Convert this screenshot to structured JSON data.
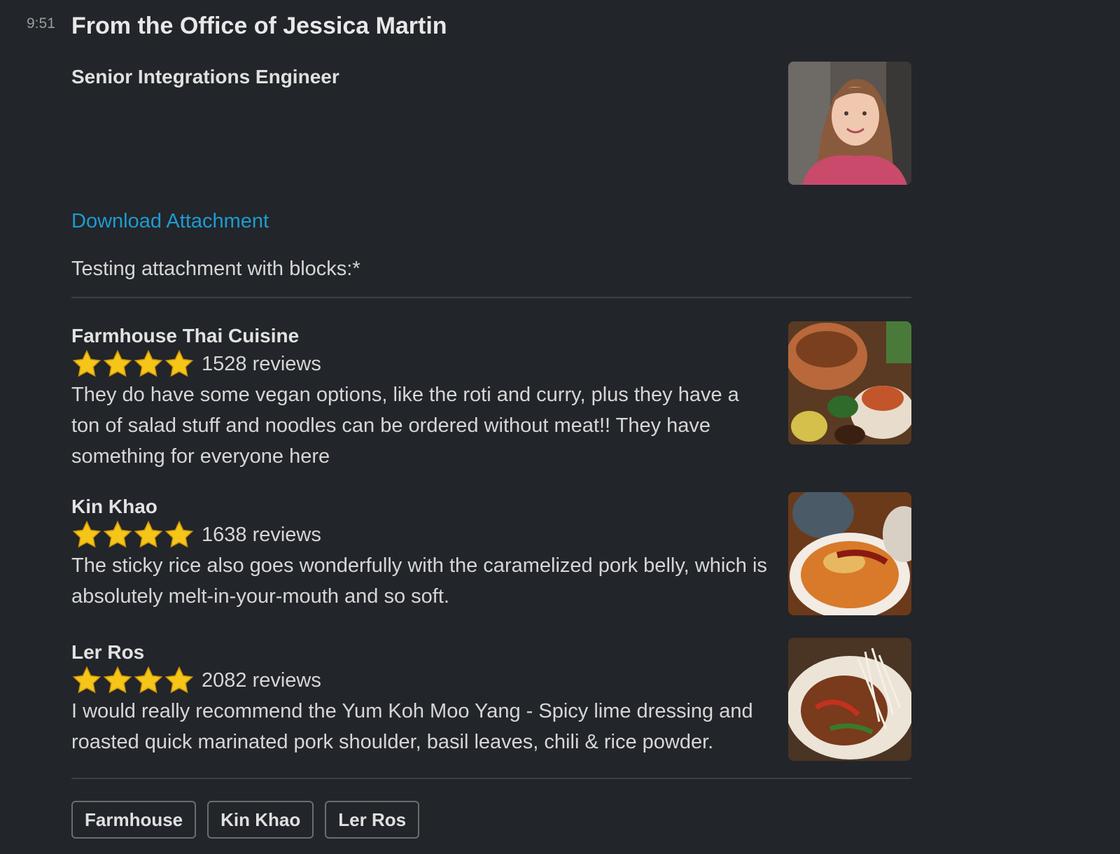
{
  "message": {
    "time": "9:51",
    "title": "From the Office of Jessica Martin",
    "subtitle": "Senior Integrations Engineer",
    "download_link": "Download Attachment",
    "intro_text": "Testing attachment with blocks:*"
  },
  "places": [
    {
      "name": "Farmhouse Thai Cuisine",
      "stars": 4,
      "reviews": "1528 reviews",
      "text": "They do have some vegan options, like the roti and curry, plus they have a ton of salad stuff and noodles can be ordered without meat!! They have something for everyone here"
    },
    {
      "name": "Kin Khao",
      "stars": 4,
      "reviews": "1638 reviews",
      "text": "The sticky rice also goes wonderfully with the caramelized pork belly, which is absolutely melt-in-your-mouth and so soft."
    },
    {
      "name": "Ler Ros",
      "stars": 4,
      "reviews": "2082 reviews",
      "text": "I would really recommend the  Yum Koh Moo Yang - Spicy lime dressing and roasted quick marinated pork shoulder, basil leaves, chili & rice powder."
    }
  ],
  "buttons": [
    "Farmhouse",
    "Kin Khao",
    "Ler Ros"
  ],
  "colors": {
    "background": "#222529",
    "link": "#1d9bd1",
    "star": "#f5c518"
  }
}
